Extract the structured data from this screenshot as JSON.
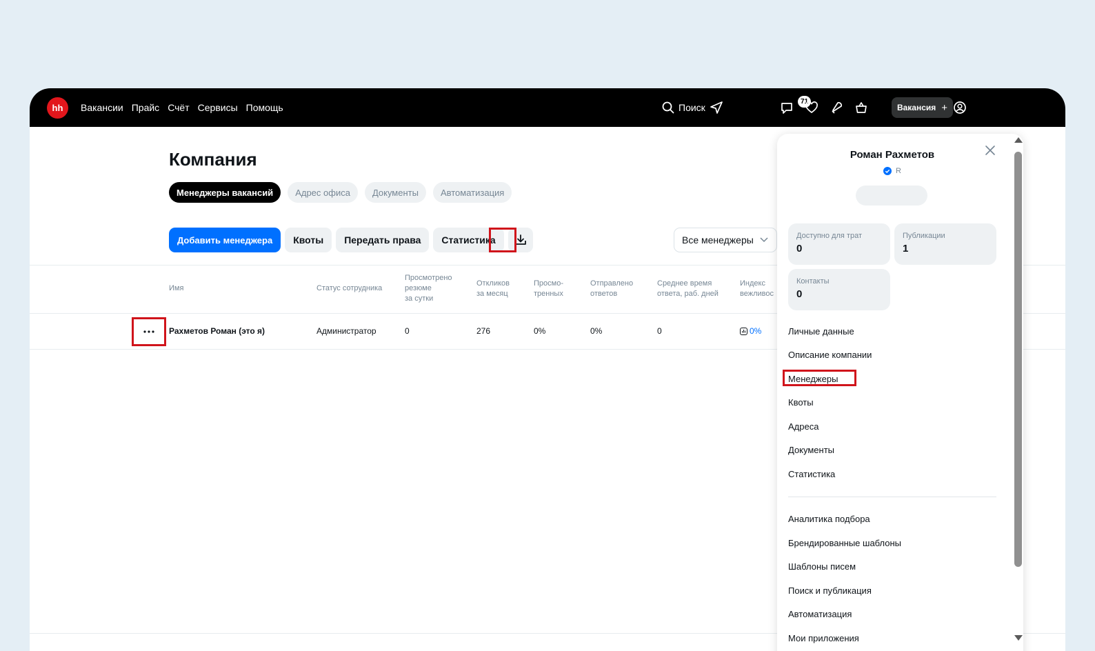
{
  "topbar": {
    "logo": "hh",
    "nav": [
      "Вакансии",
      "Прайс",
      "Счёт",
      "Сервисы",
      "Помощь"
    ],
    "search_label": "Поиск",
    "messages_badge": "71",
    "vacancy_button": "Вакансия",
    "vacancy_plus": "+"
  },
  "page": {
    "title": "Компания",
    "tabs": [
      "Менеджеры вакансий",
      "Адрес офиса",
      "Документы",
      "Автоматизация"
    ],
    "actions": {
      "add_manager": "Добавить менеджера",
      "quotas": "Квоты",
      "transfer_rights": "Передать права",
      "statistics": "Статистика"
    },
    "filter_select": "Все менеджеры"
  },
  "table": {
    "headers": [
      [
        "Имя"
      ],
      [
        "Статус сотрудника"
      ],
      [
        "Просмотрено",
        "резюме",
        "за сутки"
      ],
      [
        "Откликов",
        "за месяц"
      ],
      [
        "Просмо-",
        "тренных"
      ],
      [
        "Отправлено",
        "ответов"
      ],
      [
        "Среднее время",
        "ответа, раб. дней"
      ],
      [
        "Индекс",
        "вежливос"
      ]
    ],
    "rows": [
      {
        "name": "Рахметов Роман (это я)",
        "status": "Администратор",
        "viewed_resumes": "0",
        "responses_month": "276",
        "viewed_pct": "0%",
        "sent_answers": "0%",
        "avg_time": "0",
        "politeness": "0%"
      }
    ]
  },
  "panel": {
    "user_name": "Роман Рахметов",
    "user_sub": "R",
    "stats": [
      {
        "label": "Доступно для трат",
        "value": "0"
      },
      {
        "label": "Публикации",
        "value": "1"
      },
      {
        "label": "Контакты",
        "value": "0"
      }
    ],
    "menu_primary": [
      "Личные данные",
      "Описание компании",
      "Менеджеры",
      "Квоты",
      "Адреса",
      "Документы",
      "Статистика"
    ],
    "menu_secondary": [
      "Аналитика подбора",
      "Брендированные шаблоны",
      "Шаблоны писем",
      "Поиск и публикация",
      "Автоматизация",
      "Мои приложения"
    ]
  },
  "colors": {
    "accent": "#0070ff",
    "brand": "#e2161c",
    "highlight": "#d0141b"
  }
}
